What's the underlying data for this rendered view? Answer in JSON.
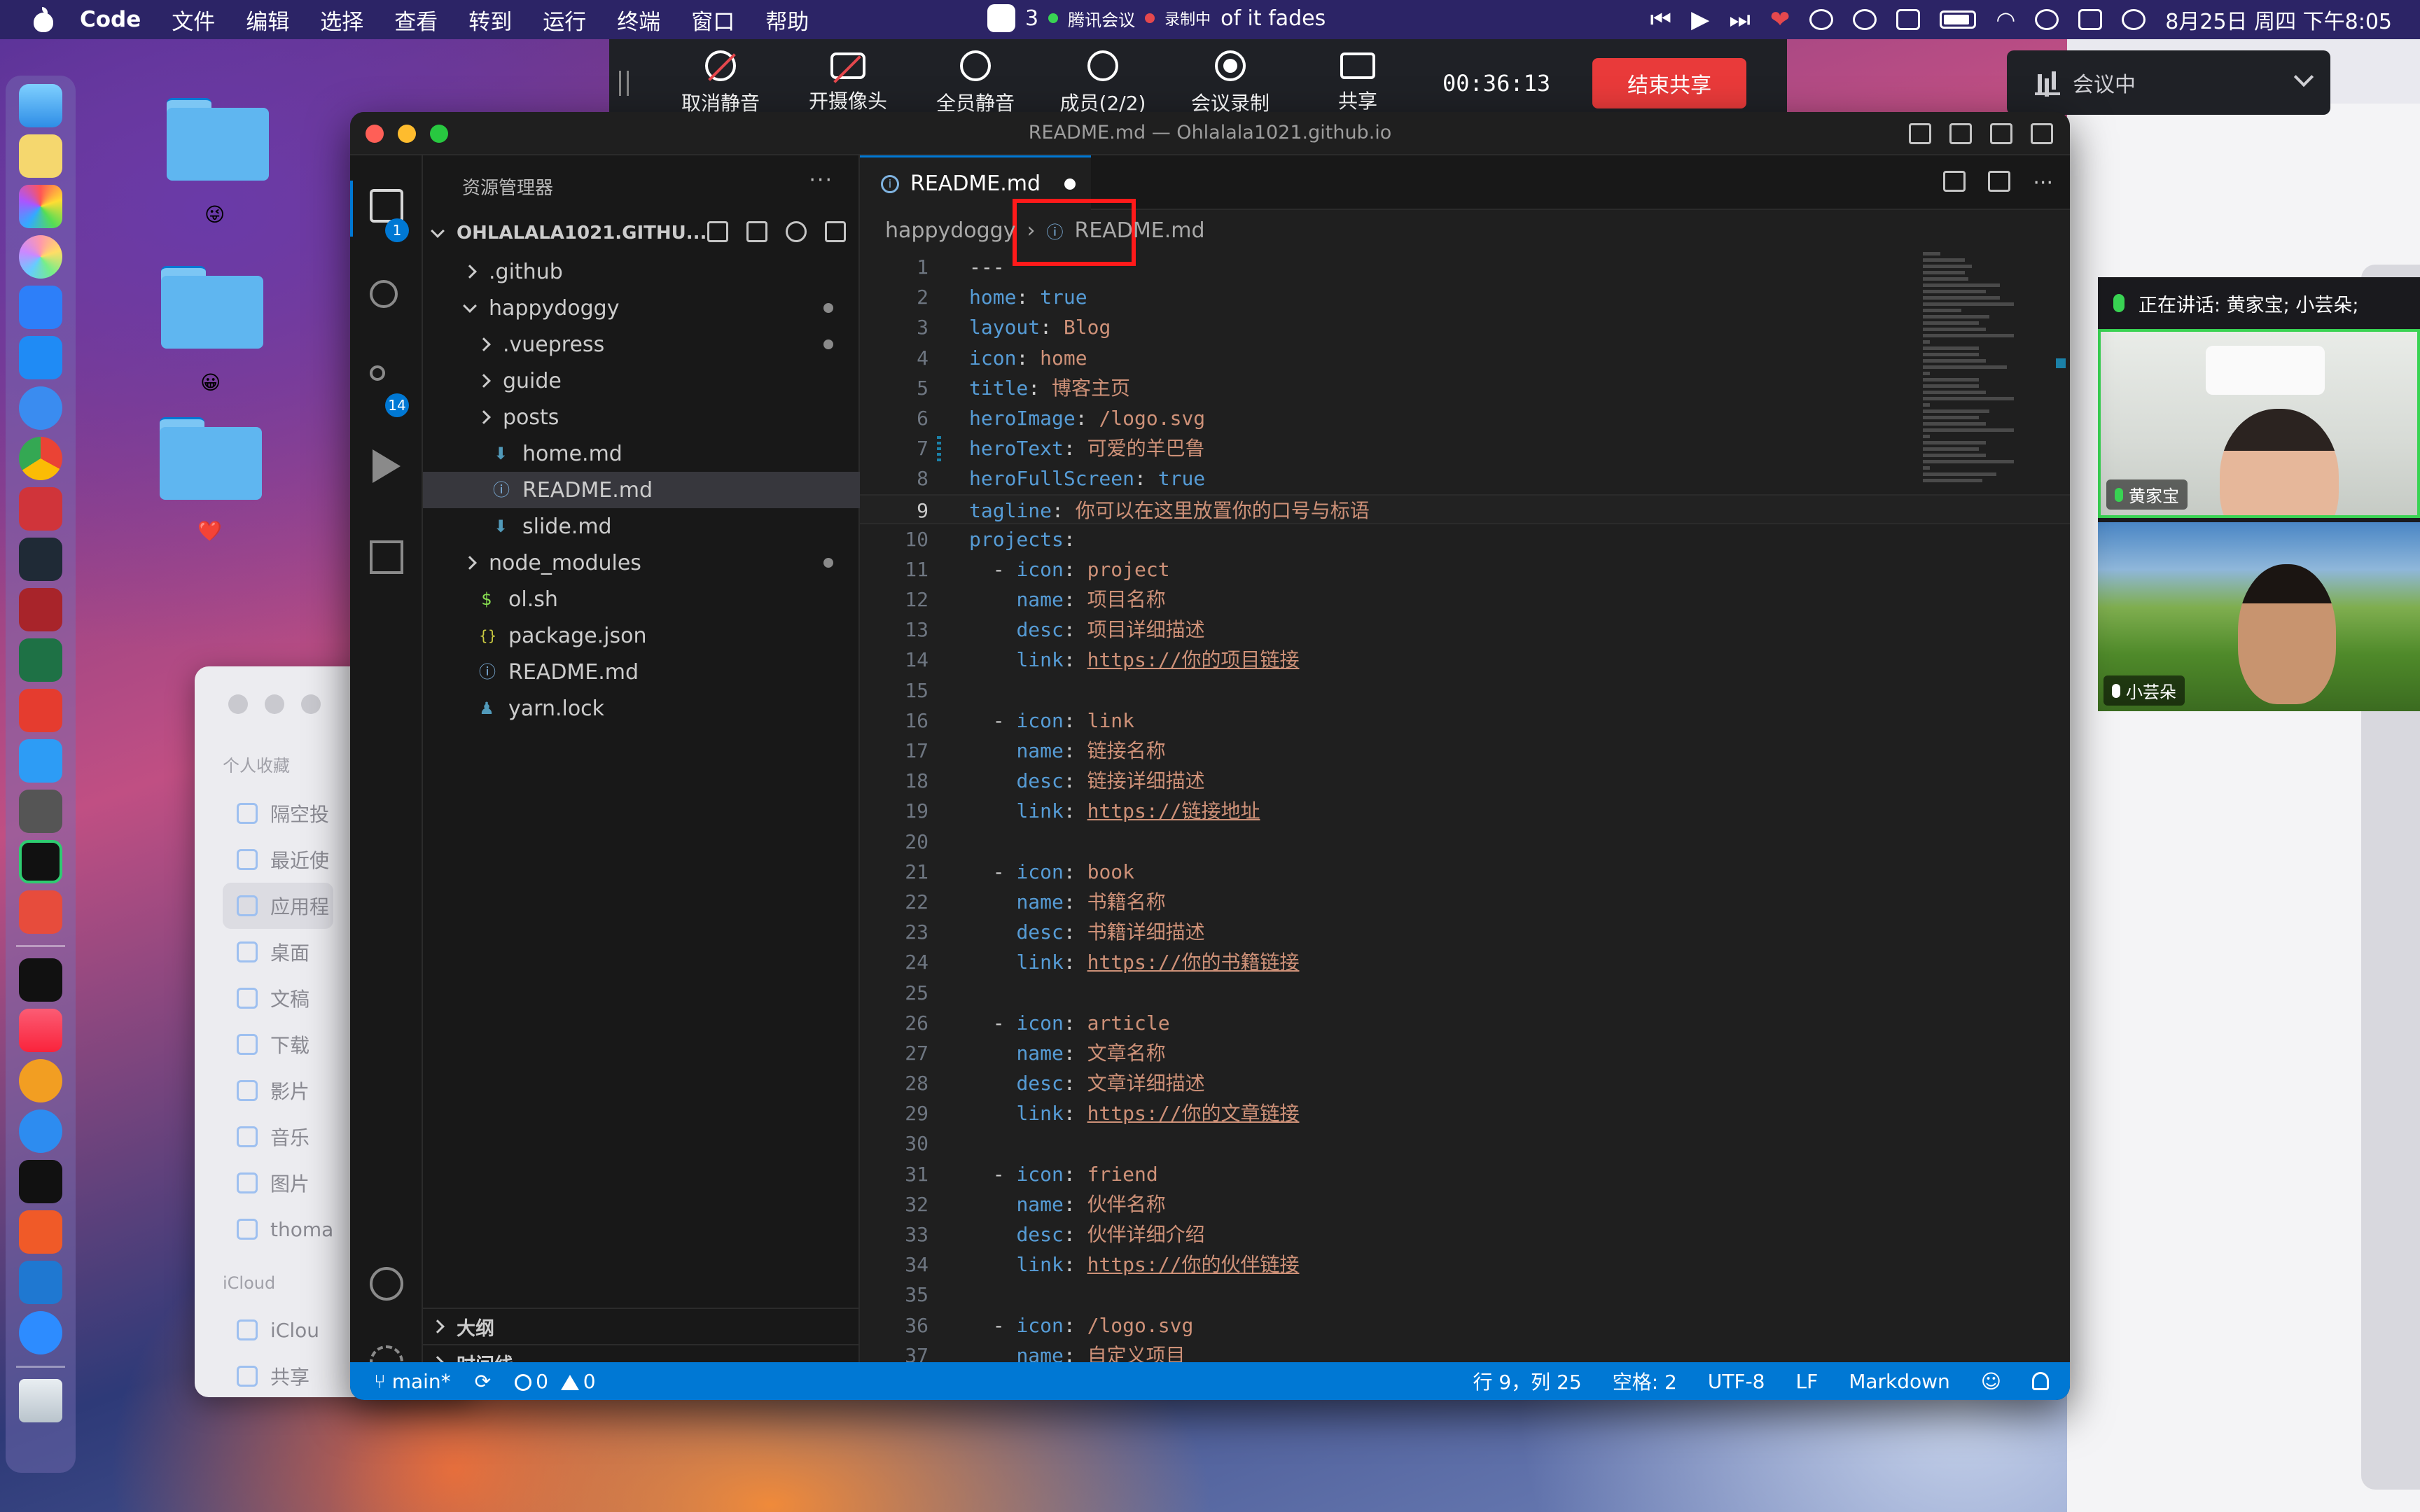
{
  "menubar": {
    "app_name": "Code",
    "items": [
      "文件",
      "编辑",
      "选择",
      "查看",
      "转到",
      "运行",
      "终端",
      "窗口",
      "帮助"
    ],
    "meeting_app": "腾讯会议",
    "recording": "录制中",
    "notification_badge": "3",
    "marquee_text": "of it fades",
    "date_time": "8月25日 周四 下午8:05"
  },
  "meeting_toolbar": {
    "buttons": [
      {
        "label": "取消静音",
        "icon": "mic-muted-icon"
      },
      {
        "label": "开摄像头",
        "icon": "camera-off-icon"
      },
      {
        "label": "全员静音",
        "icon": "mute-all-icon"
      },
      {
        "label": "成员(2/2)",
        "icon": "members-icon"
      },
      {
        "label": "会议录制",
        "icon": "record-icon"
      },
      {
        "label": "共享",
        "icon": "share-screen-icon"
      }
    ],
    "timer": "00:36:13",
    "end_share": "结束共享",
    "status": "会议中"
  },
  "video_panel": {
    "speaking": "正在讲话: 黄家宝; 小芸朵;",
    "participants": [
      {
        "name": "黄家宝"
      },
      {
        "name": "小芸朵"
      }
    ]
  },
  "finder": {
    "section_favorites": "个人收藏",
    "items": [
      "隔空投",
      "最近使",
      "应用程",
      "桌面",
      "文稿",
      "下载",
      "影片",
      "音乐",
      "图片",
      "thoma"
    ],
    "section_icloud": "iCloud",
    "icloud_items": [
      "iClou",
      "共享"
    ]
  },
  "vscode": {
    "window_title": "README.md — Ohlalala1021.github.io",
    "explorer_title": "资源管理器",
    "explorer_more": "···",
    "root_folder": "OHLALALA1021.GITHU...",
    "tree": [
      {
        "name": ".github",
        "type": "folder",
        "collapsed": true
      },
      {
        "name": "happydoggy",
        "type": "folder",
        "collapsed": false
      },
      {
        "name": ".vuepress",
        "type": "folder",
        "collapsed": true
      },
      {
        "name": "guide",
        "type": "folder",
        "collapsed": true
      },
      {
        "name": "posts",
        "type": "folder",
        "collapsed": true
      },
      {
        "name": "home.md",
        "type": "file"
      },
      {
        "name": "README.md",
        "type": "file",
        "selected": true
      },
      {
        "name": "slide.md",
        "type": "file"
      },
      {
        "name": "node_modules",
        "type": "folder",
        "collapsed": true
      },
      {
        "name": "ol.sh",
        "type": "file",
        "icon_glyph": "$"
      },
      {
        "name": "package.json",
        "type": "file",
        "icon_glyph": "{}"
      },
      {
        "name": "README.md",
        "type": "file"
      },
      {
        "name": "yarn.lock",
        "type": "file"
      }
    ],
    "outline_section": "大纲",
    "timeline_section": "时间线",
    "tab_label": "README.md",
    "breadcrumb": {
      "folder": "happydoggy",
      "file": "README.md"
    },
    "badges": {
      "explorer": "1",
      "scm": "14"
    },
    "code_lines": [
      {
        "n": "1",
        "parts": [
          [
            "d",
            "---"
          ]
        ]
      },
      {
        "n": "2",
        "parts": [
          [
            "k",
            "home"
          ],
          [
            "d",
            ": "
          ],
          [
            "b",
            "true"
          ]
        ]
      },
      {
        "n": "3",
        "parts": [
          [
            "k",
            "layout"
          ],
          [
            "d",
            ": "
          ],
          [
            "v",
            "Blog"
          ]
        ]
      },
      {
        "n": "4",
        "parts": [
          [
            "k",
            "icon"
          ],
          [
            "d",
            ": "
          ],
          [
            "v",
            "home"
          ]
        ]
      },
      {
        "n": "5",
        "parts": [
          [
            "k",
            "title"
          ],
          [
            "d",
            ": "
          ],
          [
            "v",
            "博客主页"
          ]
        ]
      },
      {
        "n": "6",
        "parts": [
          [
            "k",
            "heroImage"
          ],
          [
            "d",
            ": "
          ],
          [
            "v",
            "/logo.svg"
          ]
        ]
      },
      {
        "n": "7",
        "parts": [
          [
            "k",
            "heroText"
          ],
          [
            "d",
            ": "
          ],
          [
            "v",
            "可爱的羊巴鲁"
          ]
        ]
      },
      {
        "n": "8",
        "parts": [
          [
            "k",
            "heroFullScreen"
          ],
          [
            "d",
            ": "
          ],
          [
            "b",
            "true"
          ]
        ]
      },
      {
        "n": "9",
        "parts": [
          [
            "k",
            "tagline"
          ],
          [
            "d",
            ": "
          ],
          [
            "v",
            "你可以在这里放置你的口号与标语"
          ]
        ]
      },
      {
        "n": "10",
        "parts": [
          [
            "k",
            "projects"
          ],
          [
            "d",
            ":"
          ]
        ]
      },
      {
        "n": "11",
        "parts": [
          [
            "d",
            "  - "
          ],
          [
            "k",
            "icon"
          ],
          [
            "d",
            ": "
          ],
          [
            "v",
            "project"
          ]
        ]
      },
      {
        "n": "12",
        "parts": [
          [
            "d",
            "    "
          ],
          [
            "k",
            "name"
          ],
          [
            "d",
            ": "
          ],
          [
            "v",
            "项目名称"
          ]
        ]
      },
      {
        "n": "13",
        "parts": [
          [
            "d",
            "    "
          ],
          [
            "k",
            "desc"
          ],
          [
            "d",
            ": "
          ],
          [
            "v",
            "项目详细描述"
          ]
        ]
      },
      {
        "n": "14",
        "parts": [
          [
            "d",
            "    "
          ],
          [
            "k",
            "link"
          ],
          [
            "d",
            ": "
          ],
          [
            "u",
            "https://你的项目链接"
          ]
        ]
      },
      {
        "n": "15",
        "parts": []
      },
      {
        "n": "16",
        "parts": [
          [
            "d",
            "  - "
          ],
          [
            "k",
            "icon"
          ],
          [
            "d",
            ": "
          ],
          [
            "v",
            "link"
          ]
        ]
      },
      {
        "n": "17",
        "parts": [
          [
            "d",
            "    "
          ],
          [
            "k",
            "name"
          ],
          [
            "d",
            ": "
          ],
          [
            "v",
            "链接名称"
          ]
        ]
      },
      {
        "n": "18",
        "parts": [
          [
            "d",
            "    "
          ],
          [
            "k",
            "desc"
          ],
          [
            "d",
            ": "
          ],
          [
            "v",
            "链接详细描述"
          ]
        ]
      },
      {
        "n": "19",
        "parts": [
          [
            "d",
            "    "
          ],
          [
            "k",
            "link"
          ],
          [
            "d",
            ": "
          ],
          [
            "u",
            "https://链接地址"
          ]
        ]
      },
      {
        "n": "20",
        "parts": []
      },
      {
        "n": "21",
        "parts": [
          [
            "d",
            "  - "
          ],
          [
            "k",
            "icon"
          ],
          [
            "d",
            ": "
          ],
          [
            "v",
            "book"
          ]
        ]
      },
      {
        "n": "22",
        "parts": [
          [
            "d",
            "    "
          ],
          [
            "k",
            "name"
          ],
          [
            "d",
            ": "
          ],
          [
            "v",
            "书籍名称"
          ]
        ]
      },
      {
        "n": "23",
        "parts": [
          [
            "d",
            "    "
          ],
          [
            "k",
            "desc"
          ],
          [
            "d",
            ": "
          ],
          [
            "v",
            "书籍详细描述"
          ]
        ]
      },
      {
        "n": "24",
        "parts": [
          [
            "d",
            "    "
          ],
          [
            "k",
            "link"
          ],
          [
            "d",
            ": "
          ],
          [
            "u",
            "https://你的书籍链接"
          ]
        ]
      },
      {
        "n": "25",
        "parts": []
      },
      {
        "n": "26",
        "parts": [
          [
            "d",
            "  - "
          ],
          [
            "k",
            "icon"
          ],
          [
            "d",
            ": "
          ],
          [
            "v",
            "article"
          ]
        ]
      },
      {
        "n": "27",
        "parts": [
          [
            "d",
            "    "
          ],
          [
            "k",
            "name"
          ],
          [
            "d",
            ": "
          ],
          [
            "v",
            "文章名称"
          ]
        ]
      },
      {
        "n": "28",
        "parts": [
          [
            "d",
            "    "
          ],
          [
            "k",
            "desc"
          ],
          [
            "d",
            ": "
          ],
          [
            "v",
            "文章详细描述"
          ]
        ]
      },
      {
        "n": "29",
        "parts": [
          [
            "d",
            "    "
          ],
          [
            "k",
            "link"
          ],
          [
            "d",
            ": "
          ],
          [
            "u",
            "https://你的文章链接"
          ]
        ]
      },
      {
        "n": "30",
        "parts": []
      },
      {
        "n": "31",
        "parts": [
          [
            "d",
            "  - "
          ],
          [
            "k",
            "icon"
          ],
          [
            "d",
            ": "
          ],
          [
            "v",
            "friend"
          ]
        ]
      },
      {
        "n": "32",
        "parts": [
          [
            "d",
            "    "
          ],
          [
            "k",
            "name"
          ],
          [
            "d",
            ": "
          ],
          [
            "v",
            "伙伴名称"
          ]
        ]
      },
      {
        "n": "33",
        "parts": [
          [
            "d",
            "    "
          ],
          [
            "k",
            "desc"
          ],
          [
            "d",
            ": "
          ],
          [
            "v",
            "伙伴详细介绍"
          ]
        ]
      },
      {
        "n": "34",
        "parts": [
          [
            "d",
            "    "
          ],
          [
            "k",
            "link"
          ],
          [
            "d",
            ": "
          ],
          [
            "u",
            "https://你的伙伴链接"
          ]
        ]
      },
      {
        "n": "35",
        "parts": []
      },
      {
        "n": "36",
        "parts": [
          [
            "d",
            "  - "
          ],
          [
            "k",
            "icon"
          ],
          [
            "d",
            ": "
          ],
          [
            "v",
            "/logo.svg"
          ]
        ]
      },
      {
        "n": "37",
        "parts": [
          [
            "d",
            "    "
          ],
          [
            "k",
            "name"
          ],
          [
            "d",
            ": "
          ],
          [
            "v",
            "自定义项目"
          ]
        ]
      }
    ],
    "current_line": "9",
    "status": {
      "branch": "main*",
      "errors": "0",
      "warnings": "0",
      "cursor": "行 9，列 25",
      "spaces": "空格: 2",
      "encoding": "UTF-8",
      "eol": "LF",
      "language": "Markdown"
    }
  },
  "colors": {
    "accent": "#0078d4",
    "key": "#569cd6",
    "string": "#ce9178",
    "annotation": "#ff1a1a",
    "end_share": "#e93a3a",
    "active_speaker": "#39d353"
  }
}
